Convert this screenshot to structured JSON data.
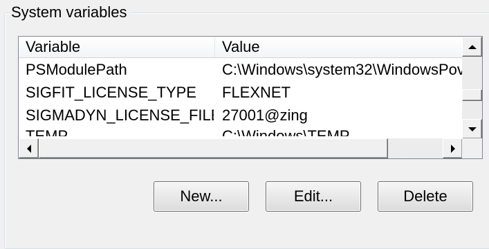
{
  "group": {
    "title": "System variables"
  },
  "columns": {
    "variable": "Variable",
    "value": "Value"
  },
  "rows": [
    {
      "variable": "PSModulePath",
      "value": "C:\\Windows\\system32\\WindowsPov"
    },
    {
      "variable": "SIGFIT_LICENSE_TYPE",
      "value": "FLEXNET"
    },
    {
      "variable": "SIGMADYN_LICENSE_FILE",
      "value": "27001@zing"
    },
    {
      "variable": "TEMP",
      "value": "C:\\Windows\\TEMP"
    }
  ],
  "buttons": {
    "new": "New...",
    "edit": "Edit...",
    "delete": "Delete"
  },
  "icons": {
    "scroll_up": "arrow-up",
    "scroll_down": "arrow-down",
    "scroll_left": "arrow-left",
    "scroll_right": "arrow-right"
  }
}
